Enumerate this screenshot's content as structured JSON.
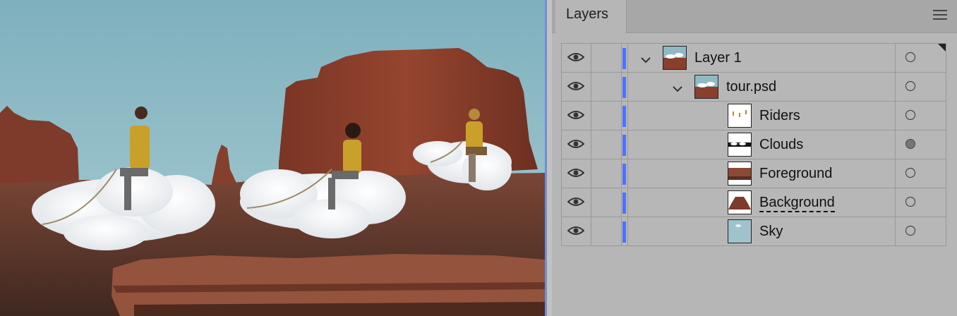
{
  "panel": {
    "tab_label": "Layers",
    "menu_icon": "hamburger-menu-icon"
  },
  "layers": [
    {
      "name": "Layer 1",
      "indent": 0,
      "expanded": true,
      "visible": true,
      "target": "empty",
      "thumb": "composite"
    },
    {
      "name": "tour.psd",
      "indent": 1,
      "expanded": true,
      "visible": true,
      "target": "empty",
      "thumb": "composite"
    },
    {
      "name": "Riders",
      "indent": 2,
      "visible": true,
      "target": "empty",
      "thumb": "riders"
    },
    {
      "name": "Clouds",
      "indent": 2,
      "visible": true,
      "target": "filled",
      "thumb": "clouds"
    },
    {
      "name": "Foreground",
      "indent": 2,
      "visible": true,
      "target": "empty",
      "thumb": "foreground"
    },
    {
      "name": "Background",
      "indent": 2,
      "visible": true,
      "target": "empty",
      "thumb": "background",
      "underlined": true
    },
    {
      "name": "Sky",
      "indent": 2,
      "visible": true,
      "target": "empty",
      "thumb": "sky"
    }
  ],
  "colors": {
    "layer_color": "#4b73ff",
    "sky": "#8fb9c4",
    "rock": "#8a3f2c"
  }
}
